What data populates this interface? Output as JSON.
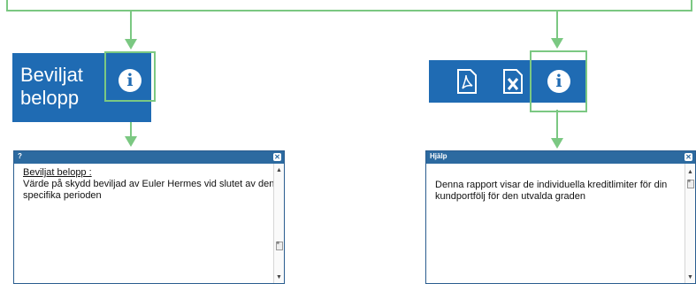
{
  "colors": {
    "accent": "#1f6bb3",
    "highlight": "#7bc882",
    "titlebar": "#2c6aa0"
  },
  "left": {
    "header_label": "Beviljat\nbelopp",
    "info_icon": "info-icon",
    "popup": {
      "title": "?",
      "heading": "Beviljat belopp :",
      "text": "Värde på skydd beviljad av Euler Hermes vid slutet av den specifika perioden"
    }
  },
  "right": {
    "toolbar_icons": [
      "pdf-icon",
      "excel-icon",
      "info-icon"
    ],
    "popup": {
      "title": "Hjälp",
      "text": "Denna rapport visar de individuella kreditlimiter för din kundportfölj för den utvalda graden"
    }
  },
  "close_glyph": "✕"
}
